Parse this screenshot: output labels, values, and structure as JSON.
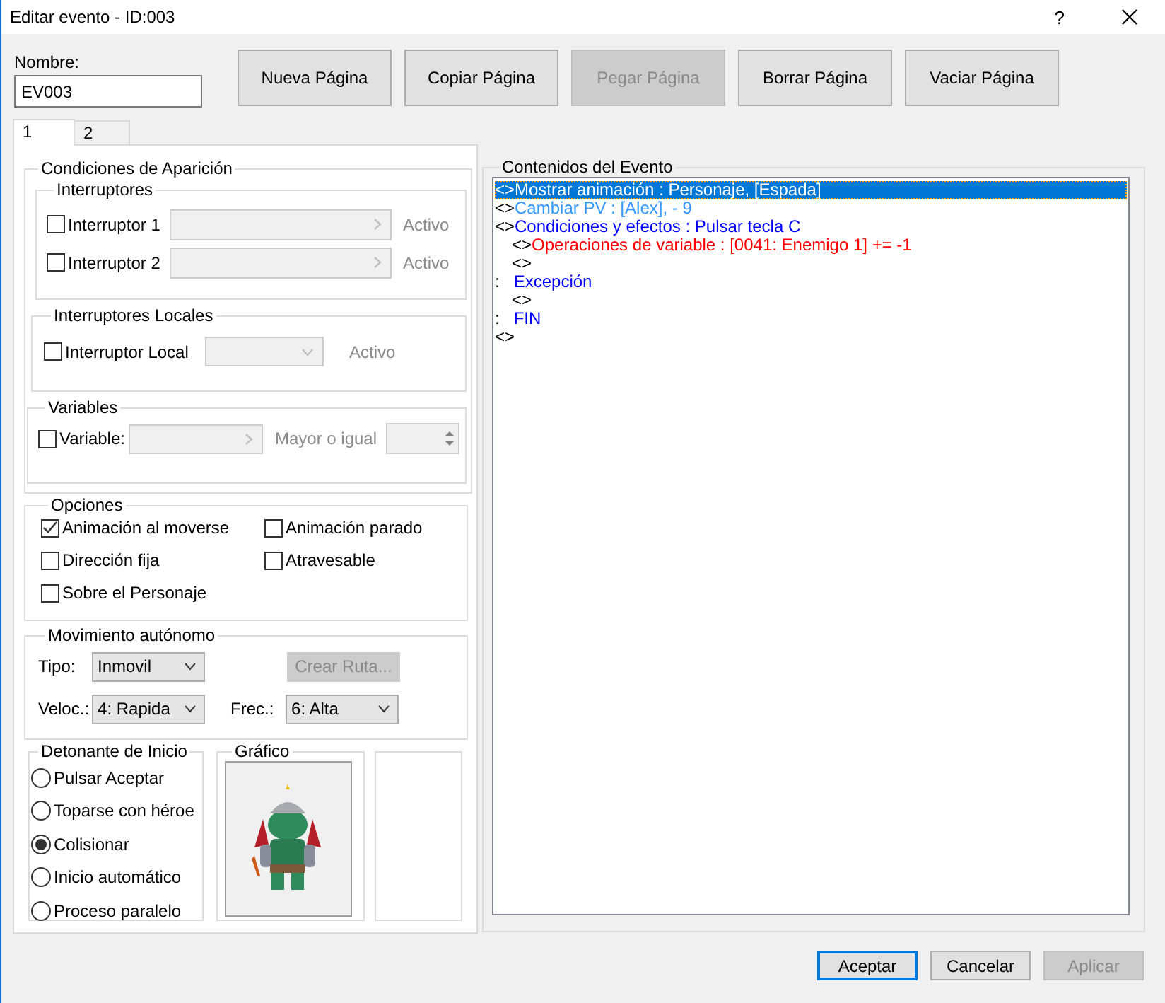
{
  "window": {
    "title": "Editar evento - ID:003",
    "help": "?"
  },
  "name": {
    "label": "Nombre:",
    "value": "EV003"
  },
  "page_buttons": [
    {
      "label": "Nueva Página",
      "disabled": false
    },
    {
      "label": "Copiar Página",
      "disabled": false
    },
    {
      "label": "Pegar Página",
      "disabled": true
    },
    {
      "label": "Borrar Página",
      "disabled": false
    },
    {
      "label": "Vaciar Página",
      "disabled": false
    }
  ],
  "tabs": [
    {
      "label": "1",
      "selected": true
    },
    {
      "label": "2",
      "selected": false
    }
  ],
  "conditions": {
    "title": "Condiciones de Aparición",
    "switches": {
      "title": "Interruptores",
      "items": [
        {
          "label": "Interruptor 1",
          "checked": false,
          "status": "Activo"
        },
        {
          "label": "Interruptor 2",
          "checked": false,
          "status": "Activo"
        }
      ]
    },
    "local_switches": {
      "title": "Interruptores Locales",
      "label": "Interruptor Local",
      "checked": false,
      "status": "Activo"
    },
    "variables": {
      "title": "Variables",
      "label": "Variable:",
      "checked": false,
      "comparison": "Mayor o igual"
    }
  },
  "options": {
    "title": "Opciones",
    "items": [
      {
        "label": "Animación al moverse",
        "checked": true
      },
      {
        "label": "Animación parado",
        "checked": false
      },
      {
        "label": "Dirección fija",
        "checked": false
      },
      {
        "label": "Atravesable",
        "checked": false
      },
      {
        "label": "Sobre el Personaje",
        "checked": false
      }
    ]
  },
  "movement": {
    "title": "Movimiento autónomo",
    "type_label": "Tipo:",
    "type_value": "Inmovil",
    "route_button": {
      "label": "Crear Ruta...",
      "disabled": true
    },
    "speed_label": "Veloc.:",
    "speed_value": "4: Rapida",
    "freq_label": "Frec.:",
    "freq_value": "6: Alta"
  },
  "trigger": {
    "title": "Detonante de Inicio",
    "items": [
      {
        "label": "Pulsar Aceptar",
        "selected": false
      },
      {
        "label": "Toparse con héroe",
        "selected": false
      },
      {
        "label": "Colisionar",
        "selected": true
      },
      {
        "label": "Inicio automático",
        "selected": false
      },
      {
        "label": "Proceso paralelo",
        "selected": false
      }
    ]
  },
  "graphic": {
    "title": "Gráfico",
    "kind": "picture"
  },
  "contents": {
    "title": "Contenidos del Evento",
    "lines": [
      {
        "marker": "<>",
        "text": "Mostrar animación : Personaje, [Espada]",
        "selected": true
      },
      {
        "marker": "<>",
        "text": "Cambiar PV : [Alex], - 9",
        "color": "#3399ff",
        "selected": false
      },
      {
        "marker": "<>",
        "text": "Condiciones y efectos : Pulsar tecla C",
        "color": "#0000ff",
        "selected": false,
        "children": [
          {
            "marker": "<>",
            "text": "Operaciones de variable : [0041: Enemigo 1] += -1",
            "color": "#ff0000",
            "selected": false
          },
          {
            "marker": "<>",
            "selected": false
          }
        ]
      },
      {
        "marker": ":",
        "text": "Excepción",
        "color": "#0000ff",
        "selected": false,
        "children": [
          {
            "marker": "<>",
            "selected": false
          }
        ]
      },
      {
        "marker": ":",
        "text": "FIN",
        "color": "#0000ff",
        "selected": false
      },
      {
        "marker": "<>",
        "selected": false
      }
    ]
  },
  "dialog_buttons": [
    {
      "label": "Aceptar",
      "disabled": false,
      "default": true
    },
    {
      "label": "Cancelar",
      "disabled": false,
      "default": false
    },
    {
      "label": "Aplicar",
      "disabled": true,
      "default": false
    }
  ]
}
